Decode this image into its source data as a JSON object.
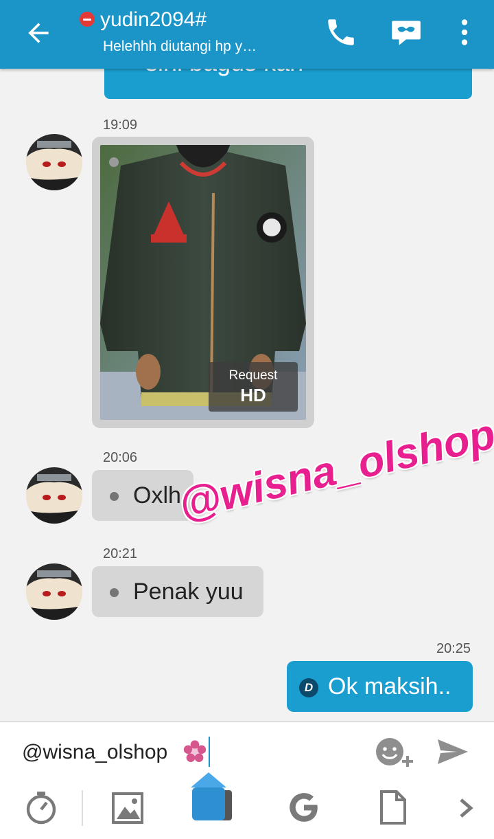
{
  "header": {
    "title": "yudin2094#",
    "subtitle": "Helehhh diutangi hp y…",
    "icons": [
      "back-arrow-icon",
      "status-blocked-icon",
      "phone-icon",
      "screen-share-icon",
      "more-vert-icon"
    ]
  },
  "messages": [
    {
      "type": "sent",
      "text": "sini bagus kan"
    },
    {
      "type": "received-image",
      "time": "19:09",
      "badge_top": "Request",
      "badge_bottom": "HD"
    },
    {
      "type": "received",
      "time": "20:06",
      "text": "Oxlh"
    },
    {
      "type": "received",
      "time": "20:21",
      "text": "Penak yuu"
    },
    {
      "type": "sent",
      "time": "20:25",
      "text": "Ok maksih..",
      "status_icon": "D"
    }
  ],
  "watermark": "@wisna_olshop",
  "composer": {
    "value": "@wisna_olshop",
    "icons": [
      "flower-emoji-icon",
      "emoji-add-icon",
      "send-icon"
    ]
  },
  "toolbar": {
    "icons": [
      "timer-icon",
      "image-icon",
      "sticker-icon",
      "google-icon",
      "file-icon",
      "chevron-right-icon"
    ]
  },
  "colors": {
    "header": "#1b95c8",
    "sent_bubble": "#1a9ed0",
    "received_bubble": "#d6d6d6",
    "watermark": "#e8208f"
  }
}
